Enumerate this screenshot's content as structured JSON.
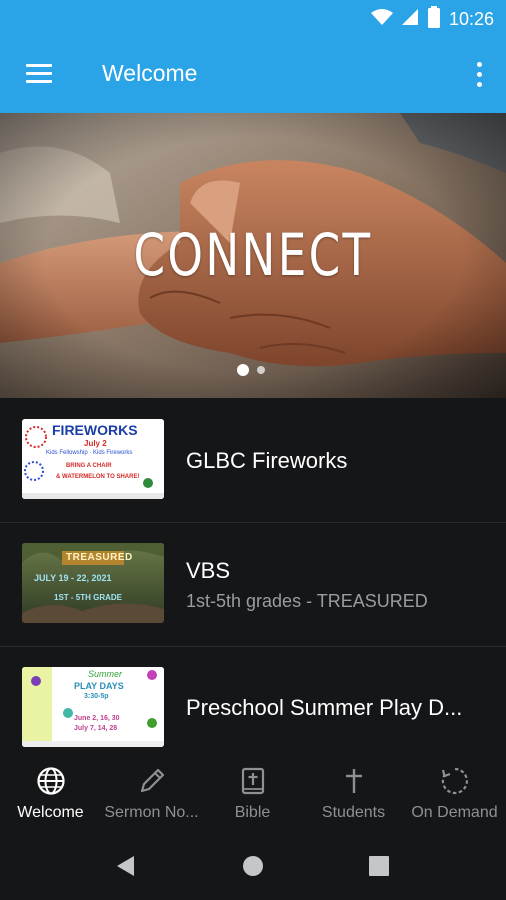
{
  "status_bar": {
    "time": "10:26",
    "icons": [
      "wifi-icon",
      "signal-icon",
      "battery-icon"
    ]
  },
  "app_bar": {
    "title": "Welcome",
    "menu_icon": "hamburger-menu-icon",
    "overflow_icon": "more-vertical-icon"
  },
  "hero": {
    "caption": "CONNECT",
    "slide_count": 2,
    "active_slide": 1
  },
  "list": [
    {
      "title": "GLBC Fireworks",
      "subtitle": "",
      "thumbnail": {
        "heading": "FIREWORKS",
        "date": "July 2",
        "line1": "Kids Fellowship · Kids Fireworks",
        "line2": "BRING A CHAIR",
        "line3": "& WATERMELON TO SHARE!"
      }
    },
    {
      "title": "VBS",
      "subtitle": "1st-5th grades - TREASURED",
      "thumbnail": {
        "heading": "TREASURED",
        "line1": "JULY 19 - 22, 2021",
        "line2": "1ST - 5TH GRADE"
      }
    },
    {
      "title": "Preschool Summer Play D...",
      "subtitle": "",
      "thumbnail": {
        "heading": "Summer",
        "line1": "PLAY DAYS",
        "line2": "3:30-5p",
        "line3": "June 2, 16, 30",
        "line4": "July 7, 14, 28"
      }
    }
  ],
  "bottom_nav": [
    {
      "label": "Welcome",
      "icon": "globe-icon",
      "active": true
    },
    {
      "label": "Sermon No...",
      "icon": "pencil-icon",
      "active": false
    },
    {
      "label": "Bible",
      "icon": "bible-icon",
      "active": false
    },
    {
      "label": "Students",
      "icon": "cross-icon",
      "active": false
    },
    {
      "label": "On Demand",
      "icon": "refresh-icon",
      "active": false
    }
  ],
  "system_nav": [
    "back-icon",
    "home-icon",
    "recents-icon"
  ],
  "colors": {
    "primary": "#2aa4e6",
    "background": "#151618",
    "text": "#ffffff",
    "muted": "#9a9c9f"
  }
}
